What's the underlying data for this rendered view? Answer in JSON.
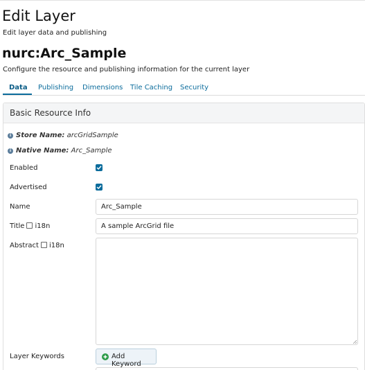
{
  "page": {
    "title": "Edit Layer",
    "subtitle": "Edit layer data and publishing",
    "layer_name": "nurc:Arc_Sample",
    "layer_description": "Configure the resource and publishing information for the current layer"
  },
  "tabs": [
    {
      "label": "Data",
      "active": true
    },
    {
      "label": "Publishing",
      "active": false
    },
    {
      "label": "Dimensions",
      "active": false
    },
    {
      "label": "Tile Caching",
      "active": false
    },
    {
      "label": "Security",
      "active": false
    }
  ],
  "panel": {
    "title": "Basic Resource Info",
    "store": {
      "key": "Store Name:",
      "value": "arcGridSample"
    },
    "native": {
      "key": "Native Name:",
      "value": "Arc_Sample"
    },
    "enabled": {
      "label": "Enabled",
      "checked": true
    },
    "advertised": {
      "label": "Advertised",
      "checked": true
    },
    "name": {
      "label": "Name",
      "value": "Arc_Sample"
    },
    "title_field": {
      "label": "Title",
      "i18n": "i18n",
      "i18n_checked": false,
      "value": "A sample ArcGrid file"
    },
    "abstract": {
      "label": "Abstract",
      "i18n": "i18n",
      "i18n_checked": false,
      "value": ""
    },
    "keywords": {
      "label": "Layer Keywords",
      "button": "Add Keyword"
    }
  },
  "colors": {
    "accent": "#0b6c9c",
    "add_icon": "#2e9c4a",
    "info_icon": "#5b7d9b"
  }
}
